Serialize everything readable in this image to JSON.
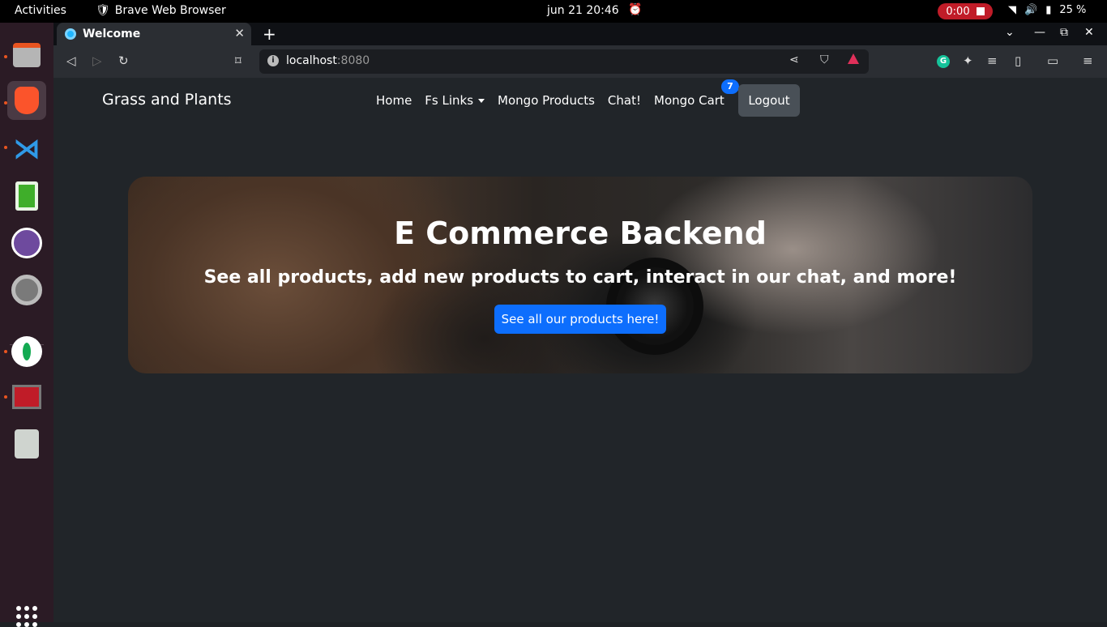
{
  "system": {
    "activities": "Activities",
    "app_name": "Brave Web Browser",
    "clock": "jun 21  20:46",
    "recording": "0:00",
    "battery": "25 %"
  },
  "browser": {
    "tab_title": "Welcome",
    "url_host": "localhost",
    "url_port": ":8080"
  },
  "site": {
    "brand": "Grass and Plants",
    "nav": {
      "home": "Home",
      "fs_links": "Fs Links",
      "mongo_products": "Mongo Products",
      "chat": "Chat!",
      "mongo_cart": "Mongo Cart",
      "cart_count": "7",
      "logout": "Logout"
    },
    "hero": {
      "title": "E Commerce Backend",
      "subtitle": "See all products, add new products to cart, interact in our chat, and more!",
      "cta": "See all our products here!"
    }
  },
  "colors": {
    "page_bg": "#212529",
    "primary": "#0d6efd",
    "logout_bg": "#495057",
    "recording": "#c01c28"
  }
}
